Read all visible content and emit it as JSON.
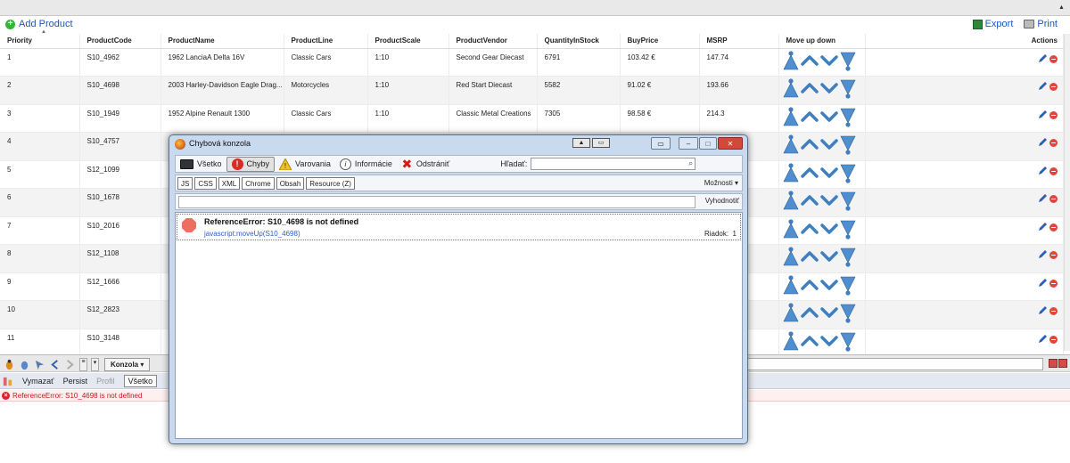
{
  "grid": {
    "toolbar": {
      "add_label": "Add Product",
      "export_label": "Export",
      "print_label": "Print"
    },
    "columns": [
      "Priority",
      "ProductCode",
      "ProductName",
      "ProductLine",
      "ProductScale",
      "ProductVendor",
      "QuantityInStock",
      "BuyPrice",
      "MSRP",
      "Move up down",
      "Actions"
    ],
    "rows": [
      {
        "priority": "1",
        "code": "S10_4962",
        "name": "1962 LanciaA Delta 16V",
        "line": "Classic Cars",
        "scale": "1:10",
        "vendor": "Second Gear Diecast",
        "qty": "6791",
        "buy": "103.42 €",
        "msrp": "147.74"
      },
      {
        "priority": "2",
        "code": "S10_4698",
        "name": "2003 Harley-Davidson Eagle Drag...",
        "line": "Motorcycles",
        "scale": "1:10",
        "vendor": "Red Start Diecast",
        "qty": "5582",
        "buy": "91.02 €",
        "msrp": "193.66"
      },
      {
        "priority": "3",
        "code": "S10_1949",
        "name": "1952 Alpine Renault 1300",
        "line": "Classic Cars",
        "scale": "1:10",
        "vendor": "Classic Metal Creations",
        "qty": "7305",
        "buy": "98.58 €",
        "msrp": "214.3"
      },
      {
        "priority": "4",
        "code": "S10_4757",
        "name": "",
        "line": "",
        "scale": "",
        "vendor": "",
        "qty": "",
        "buy": "",
        "msrp": ""
      },
      {
        "priority": "5",
        "code": "S12_1099",
        "name": "",
        "line": "",
        "scale": "",
        "vendor": "",
        "qty": "",
        "buy": "",
        "msrp": ""
      },
      {
        "priority": "6",
        "code": "S10_1678",
        "name": "",
        "line": "",
        "scale": "",
        "vendor": "",
        "qty": "",
        "buy": "",
        "msrp": ""
      },
      {
        "priority": "7",
        "code": "S10_2016",
        "name": "",
        "line": "",
        "scale": "",
        "vendor": "",
        "qty": "",
        "buy": "",
        "msrp": ""
      },
      {
        "priority": "8",
        "code": "S12_1108",
        "name": "",
        "line": "",
        "scale": "",
        "vendor": "",
        "qty": "",
        "buy": "",
        "msrp": ""
      },
      {
        "priority": "9",
        "code": "S12_1666",
        "name": "",
        "line": "",
        "scale": "",
        "vendor": "",
        "qty": "",
        "buy": "",
        "msrp": ""
      },
      {
        "priority": "10",
        "code": "S12_2823",
        "name": "",
        "line": "",
        "scale": "",
        "vendor": "",
        "qty": "",
        "buy": "",
        "msrp": ""
      },
      {
        "priority": "11",
        "code": "S10_3148",
        "name": "",
        "line": "",
        "scale": "",
        "vendor": "",
        "qty": "",
        "buy": "",
        "msrp": ""
      }
    ]
  },
  "firebug": {
    "console_tab": "Konzola",
    "clear_label": "Vymazať",
    "persist_label": "Persist",
    "profile_label": "Profil",
    "all_tab": "Všetko",
    "error_line": "ReferenceError: S10_4698 is not defined"
  },
  "error_console": {
    "title": "Chybová konzola",
    "toolbar": {
      "all": "Všetko",
      "errors": "Chyby",
      "warnings": "Varovania",
      "info": "Informácie",
      "clear": "Odstrániť",
      "search_label": "Hľadať:",
      "search_value": ""
    },
    "filters": [
      "JS",
      "CSS",
      "XML",
      "Chrome",
      "Obsah",
      "Resource (Z)"
    ],
    "options_label": "Možnosti",
    "evaluate_label": "Vyhodnotiť",
    "entries": [
      {
        "message": "ReferenceError: S10_4698 is not defined",
        "source": "javascript:moveUp(S10_4698)",
        "line_label": "Riadok:",
        "line": "1"
      }
    ]
  },
  "colors": {
    "link": "#1a55c4",
    "error": "#c0161a",
    "arrow": "#3f7fbf"
  }
}
